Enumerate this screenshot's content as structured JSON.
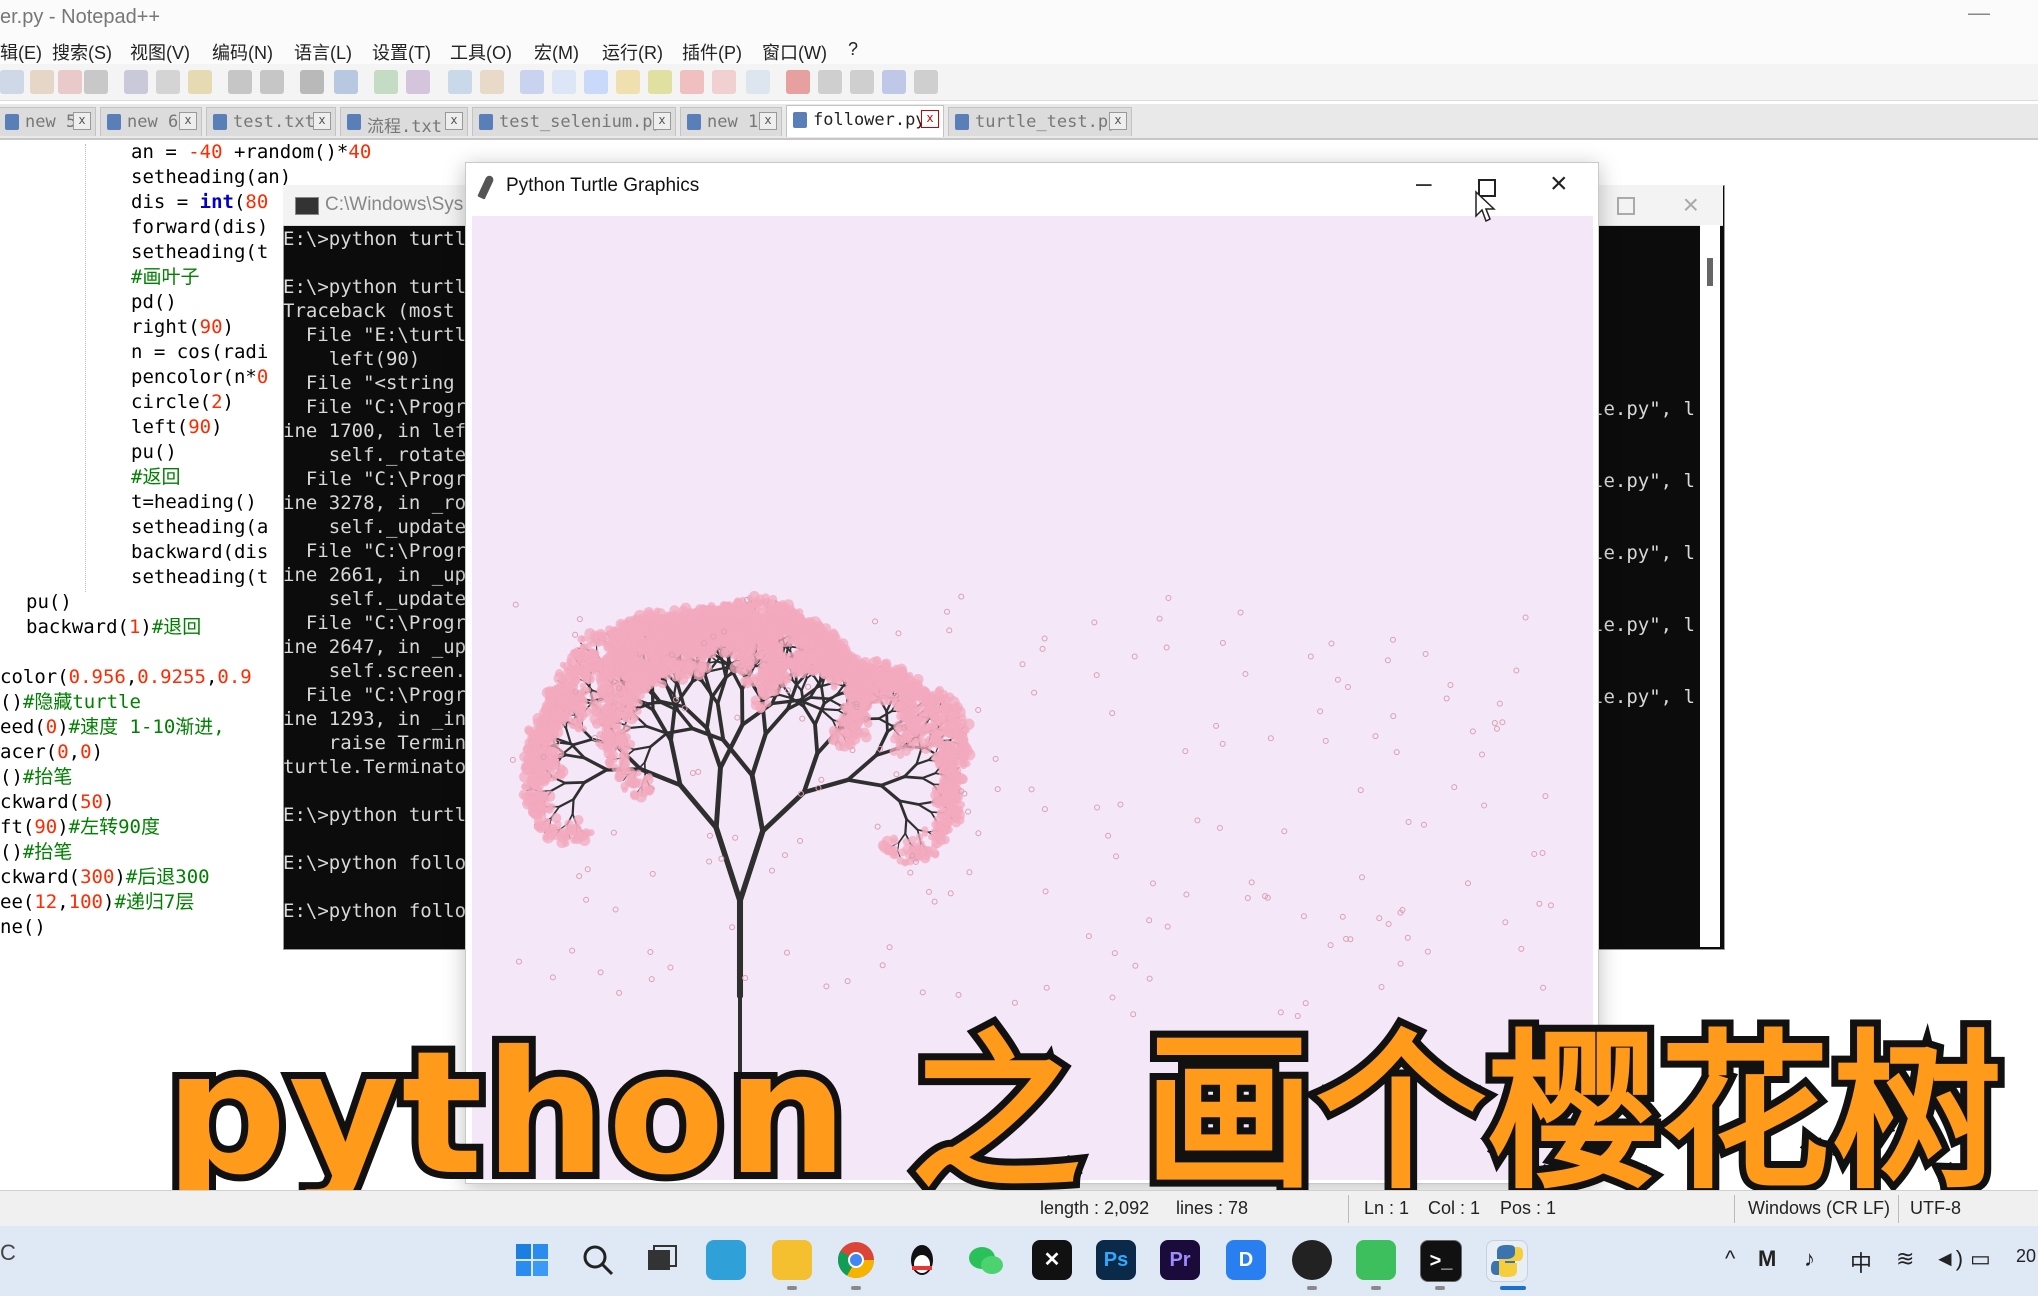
{
  "notepad": {
    "title": "er.py - Notepad++",
    "menu": [
      "辑(E)",
      "搜索(S)",
      "视图(V)",
      "编码(N)",
      "语言(L)",
      "设置(T)",
      "工具(O)",
      "宏(M)",
      "运行(R)",
      "插件(P)",
      "窗口(W)",
      "?"
    ],
    "tabs": [
      {
        "label": "new 5",
        "active": false
      },
      {
        "label": "new 6",
        "active": false
      },
      {
        "label": "test.txt",
        "active": false
      },
      {
        "label": "流程.txt",
        "active": false
      },
      {
        "label": "test_selenium.py",
        "active": false
      },
      {
        "label": "new 1",
        "active": false
      },
      {
        "label": "follower.py",
        "active": true
      },
      {
        "label": "turtle_test.py",
        "active": false
      }
    ],
    "close_glyph": "x"
  },
  "code": {
    "l1a": "an = ",
    "l1b": "-40",
    "l1c": " +random()*",
    "l1d": "40",
    "l2": "setheading(an)",
    "l3a": "dis = ",
    "l3b": "int",
    "l3c": "(",
    "l3d": "80",
    "l4": "forward(dis)",
    "l5": "setheading(t",
    "l6": "#画叶子",
    "l7": "pd()",
    "l8a": "right(",
    "l8b": "90",
    "l8c": ")",
    "l9": "n = cos(radi",
    "l10a": "pencolor(n*",
    "l10b": "0",
    "l11a": "circle(",
    "l11b": "2",
    "l11c": ")",
    "l12a": "left(",
    "l12b": "90",
    "l12c": ")",
    "l13": "pu()",
    "l14": "#返回",
    "l15": "t=heading()",
    "l16": "setheading(a",
    "l17": "backward(dis",
    "l18": "setheading(t",
    "l19": "pu()",
    "l20a": "backward(",
    "l20b": "1",
    "l20c": ")",
    "l20d": "#退回",
    "l21a": "color(",
    "l21b": "0.956",
    "l21c": ",",
    "l21d": "0.9255",
    "l21e": ",",
    "l21f": "0.9",
    "l22a": "()",
    "l22b": "#隐藏turtle",
    "l23a": "eed(",
    "l23b": "0",
    "l23c": ")",
    "l23d": "#速度 1-10渐进,",
    "l24a": "acer(",
    "l24b": "0",
    "l24c": ",",
    "l24d": "0",
    "l24e": ")",
    "l25a": "()",
    "l25b": "#抬笔",
    "l26a": "ckward(",
    "l26b": "50",
    "l26c": ")",
    "l27a": "ft(",
    "l27b": "90",
    "l27c": ")",
    "l27d": "#左转90度",
    "l28a": "()",
    "l28b": "#抬笔",
    "l29a": "ckward(",
    "l29b": "300",
    "l29c": ")",
    "l29d": "#后退300",
    "l30a": "ee(",
    "l30b": "12",
    "l30c": ",",
    "l30d": "100",
    "l30e": ")",
    "l30f": "#递归7层",
    "l31": "ne()"
  },
  "console": {
    "title": "C:\\Windows\\Sys",
    "lines": [
      "E:\\>python turtl",
      "",
      "E:\\>python turtl",
      "Traceback (most",
      "  File \"E:\\turtl",
      "    left(90)",
      "  File \"<string",
      "  File \"C:\\Progr",
      "ine 1700, in lef",
      "    self._rotate",
      "  File \"C:\\Progr",
      "ine 3278, in _ro",
      "    self._update",
      "  File \"C:\\Progr",
      "ine 2661, in _up",
      "    self._update",
      "  File \"C:\\Progr",
      "ine 2647, in _up",
      "    self.screen.",
      "  File \"C:\\Progr",
      "ine 1293, in _in",
      "    raise Termin",
      "turtle.Terminato",
      "",
      "E:\\>python turtl",
      "",
      "E:\\>python follo",
      "",
      "E:\\>python follo"
    ],
    "right_fragment": "le.py\", l"
  },
  "turtle_window": {
    "title": "Python Turtle Graphics"
  },
  "caption": "python 之 画个樱花树",
  "statusbar": {
    "length": "length : 2,092",
    "lines": "lines : 78",
    "ln": "Ln : 1",
    "col": "Col : 1",
    "pos": "Pos : 1",
    "eol": "Windows (CR LF)",
    "encoding": "UTF-8",
    "left_fragment": "C"
  },
  "taskbar": {
    "apps": [
      "start-icon",
      "search-icon",
      "task-view-icon",
      "desktop-icon",
      "file-explorer-icon",
      "chrome-icon",
      "qq-icon",
      "wechat-icon",
      "capcut-icon",
      "photoshop-icon",
      "premiere-icon",
      "dingtalk-icon",
      "obs-icon",
      "pycharm-icon",
      "terminal-icon",
      "python-icon"
    ],
    "ps_label": "Ps",
    "pr_label": "Pr",
    "ime": "中",
    "clock_fragment": "20"
  },
  "colors": {
    "caption_fill": "#ff9a1a",
    "canvas_bg": "#f4e7f8",
    "blossom": "#f3a9bd",
    "branch": "#2f2f2f"
  }
}
